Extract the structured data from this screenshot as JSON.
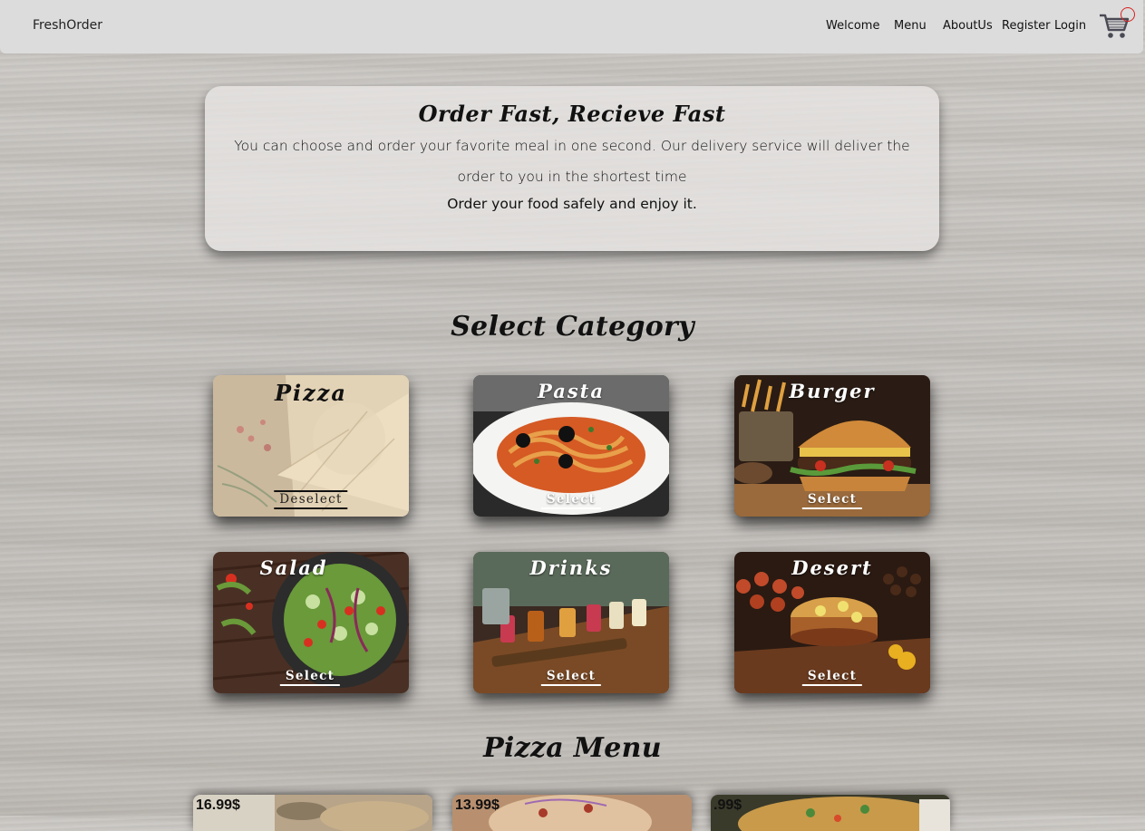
{
  "nav": {
    "brand": "FreshOrder",
    "links": [
      "Welcome",
      "Menu",
      "AboutUs",
      "Register",
      "Login"
    ],
    "cart_icon": "cart-icon",
    "badge_color": "#d92020"
  },
  "hero": {
    "title": "Order Fast, Recieve Fast",
    "text": "You can choose and order your favorite meal in one second. Our delivery service will deliver the order to you in the shortest time",
    "sub": "Order your food safely and enjoy it."
  },
  "categories": {
    "title": "Select Category",
    "items": [
      {
        "name": "Pizza",
        "button": "Deselect",
        "selected": true
      },
      {
        "name": "Pasta",
        "button": "Select",
        "selected": false
      },
      {
        "name": "Burger",
        "button": "Select",
        "selected": false
      },
      {
        "name": "Salad",
        "button": "Select",
        "selected": false
      },
      {
        "name": "Drinks",
        "button": "Select",
        "selected": false
      },
      {
        "name": "Desert",
        "button": "Select",
        "selected": false
      }
    ]
  },
  "menu": {
    "title": "Pizza Menu",
    "items": [
      {
        "price": "16.99$"
      },
      {
        "price": "13.99$"
      },
      {
        "price": ".99$"
      }
    ]
  }
}
